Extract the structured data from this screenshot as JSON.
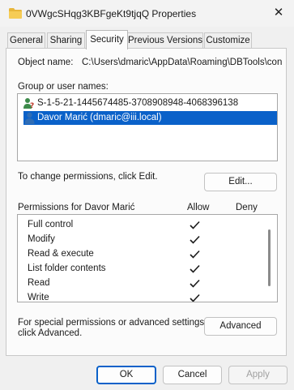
{
  "window": {
    "title": "0VWgcSHqg3KBFgeKt9tjqQ Properties",
    "close_glyph": "✕"
  },
  "tabs": [
    {
      "label": "General",
      "active": false
    },
    {
      "label": "Sharing",
      "active": false
    },
    {
      "label": "Security",
      "active": true
    },
    {
      "label": "Previous Versions",
      "active": false
    },
    {
      "label": "Customize",
      "active": false
    }
  ],
  "security": {
    "object_name_label": "Object name:",
    "object_name_value": "C:\\Users\\dmaric\\AppData\\Roaming\\DBTools\\con",
    "group_label": "Group or user names:",
    "users": [
      {
        "name": "S-1-5-21-1445674485-3708908948-4068396138",
        "icon": "unknown-user-icon",
        "selected": false
      },
      {
        "name": "Davor Marić (dmaric@iii.local)",
        "icon": "user-icon",
        "selected": true
      }
    ],
    "change_hint": "To change permissions, click Edit.",
    "edit_button": "Edit...",
    "permissions_header": "Permissions for Davor Marić",
    "allow_header": "Allow",
    "deny_header": "Deny",
    "permissions": [
      {
        "name": "Full control",
        "allow": true,
        "deny": false
      },
      {
        "name": "Modify",
        "allow": true,
        "deny": false
      },
      {
        "name": "Read & execute",
        "allow": true,
        "deny": false
      },
      {
        "name": "List folder contents",
        "allow": true,
        "deny": false
      },
      {
        "name": "Read",
        "allow": true,
        "deny": false
      },
      {
        "name": "Write",
        "allow": true,
        "deny": false
      }
    ],
    "special_hint_line1": "For special permissions or advanced settings,",
    "special_hint_line2": "click Advanced.",
    "advanced_button": "Advanced"
  },
  "footer": {
    "ok": "OK",
    "cancel": "Cancel",
    "apply": "Apply"
  },
  "colors": {
    "accent": "#0a61c9",
    "folder": "#e8b63a",
    "disabled_text": "#a0a0a0"
  }
}
